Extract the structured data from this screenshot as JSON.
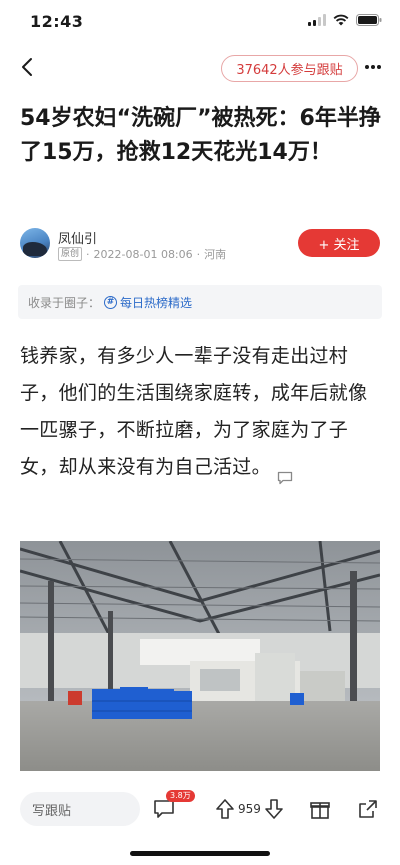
{
  "status_bar": {
    "time": "12:43"
  },
  "nav": {
    "participants_label": "37642人参与跟贴"
  },
  "article": {
    "title": "54岁农妇“洗碗厂”被热死：6年半挣了15万，抢救12天花光14万！",
    "author": {
      "name": "凤仙引",
      "badge": "原创",
      "date": "2022-08-01 08:06",
      "separator": "·",
      "location": "河南"
    },
    "follow_label": "+ 关注",
    "collected": {
      "label": "收录于圈子：",
      "circle": "每日热榜精选"
    },
    "body": "钱养家，有多少人一辈子没有走出过村子，他们的生活围绕家庭转，成年后就像一匹骡子，不断拉磨，为了家庭为了子女，却从来没有为自己活过。"
  },
  "bottom_bar": {
    "comment_placeholder": "写跟贴",
    "comment_count": "3.8万",
    "like_count": "959"
  },
  "colors": {
    "accent": "#e53935",
    "link": "#2c6bc9"
  },
  "icons": [
    "back-icon",
    "more-icon",
    "signal-icon",
    "wifi-icon",
    "battery-icon",
    "hash-icon",
    "comment-icon",
    "upvote-icon",
    "downvote-icon",
    "gift-icon",
    "share-icon"
  ]
}
